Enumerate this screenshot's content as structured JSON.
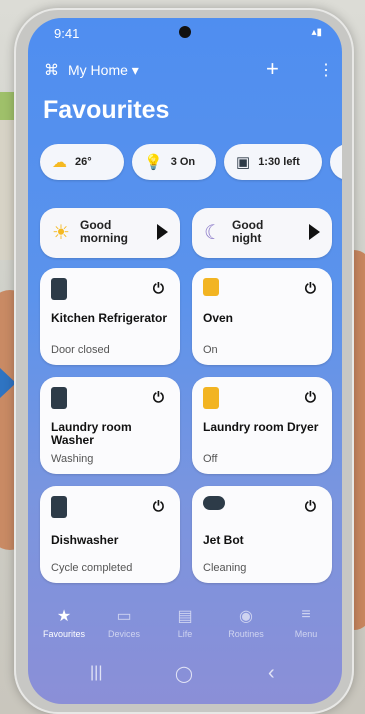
{
  "status": {
    "time": "9:41",
    "icons": "▴▮"
  },
  "header": {
    "home_icon": "home-grid-icon",
    "home_label": "My Home ▾",
    "add_symbol": "+",
    "more_symbol": "⋮"
  },
  "title": "Favourites",
  "chips": [
    {
      "icon": "☁",
      "text": "26°"
    },
    {
      "icon": "💡",
      "text": "3 On"
    },
    {
      "icon": "▣",
      "text": "1:30 left"
    }
  ],
  "scenes": [
    {
      "icon": "☀",
      "label": "Good\nmorning"
    },
    {
      "icon": "☾",
      "label": "Good\nnight"
    }
  ],
  "power_symbol": "⏻",
  "devices": [
    {
      "name": "Kitchen Refrigerator",
      "state": "Door closed",
      "color": "#2d3b48"
    },
    {
      "name": "Oven",
      "state": "On",
      "color": "#f2b422"
    },
    {
      "name": "Laundry room Washer",
      "state": "Washing",
      "color": "#2d3b48"
    },
    {
      "name": "Laundry room Dryer",
      "state": "Off",
      "color": "#f2b422"
    },
    {
      "name": "Dishwasher",
      "state": "Cycle completed",
      "color": "#2d3b48"
    },
    {
      "name": "Jet Bot",
      "state": "Cleaning",
      "color": "#2d3b48"
    }
  ],
  "nav": [
    {
      "icon": "★",
      "label": "Favourites"
    },
    {
      "icon": "▭",
      "label": "Devices"
    },
    {
      "icon": "▤",
      "label": "Life"
    },
    {
      "icon": "◉",
      "label": "Routines"
    },
    {
      "icon": "≡",
      "label": "Menu"
    }
  ],
  "system": {
    "recent": "|||",
    "home": "◯",
    "back": "‹"
  }
}
